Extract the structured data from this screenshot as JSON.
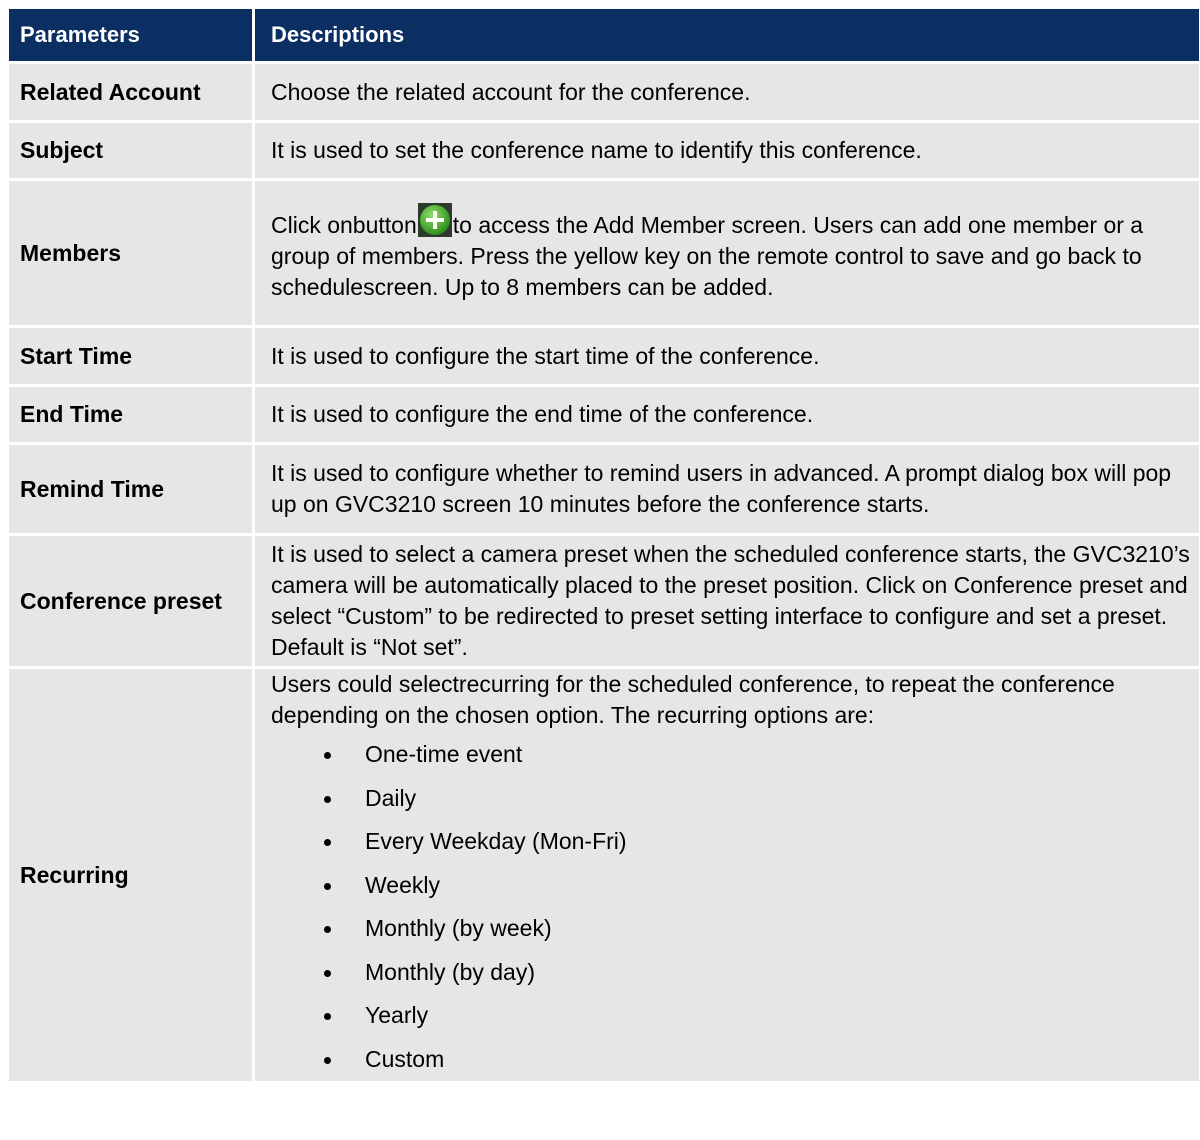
{
  "header": {
    "parameters": "Parameters",
    "descriptions": "Descriptions"
  },
  "rows": {
    "related_account": {
      "param": "Related Account",
      "desc": "Choose the related account for the conference."
    },
    "subject": {
      "param": "Subject",
      "desc": "It is used to set the conference name to identify this conference."
    },
    "members": {
      "param": "Members",
      "desc_before_icon": "Click onbutton",
      "desc_after_icon": "to access the Add Member screen. Users can add one member or a group of members. Press the yellow key on the remote control to save and go back to schedulescreen. Up to 8 members can be added.",
      "icon": "add-plus-icon",
      "icon_color": "#4caf2a"
    },
    "start_time": {
      "param": "Start Time",
      "desc": "It is used to configure the start time of the conference."
    },
    "end_time": {
      "param": "End Time",
      "desc": "It is used to configure the end time of the conference."
    },
    "remind_time": {
      "param": "Remind Time",
      "desc": "It is used to configure whether to remind users in advanced. A prompt dialog box will pop up on GVC3210 screen 10 minutes before the conference starts."
    },
    "conference_preset": {
      "param": "Conference preset",
      "desc": "It is used to select a camera preset when the scheduled conference starts, the GVC3210’s camera will be automatically placed to the preset position. Click on Conference preset and select “Custom” to be redirected to preset setting interface to configure and set a preset. Default is “Not set”."
    },
    "recurring": {
      "param": "Recurring",
      "desc": "Users could selectrecurring for the scheduled conference, to repeat the conference depending on the chosen option. The recurring options are:",
      "options": [
        "One-time event",
        "Daily",
        "Every Weekday (Mon-Fri)",
        "Weekly",
        "Monthly (by week)",
        "Monthly (by day)",
        "Yearly",
        "Custom"
      ]
    }
  },
  "colors": {
    "header_bg": "#0b2f63",
    "header_text": "#ffffff",
    "row_bg": "#e6e6e6"
  }
}
